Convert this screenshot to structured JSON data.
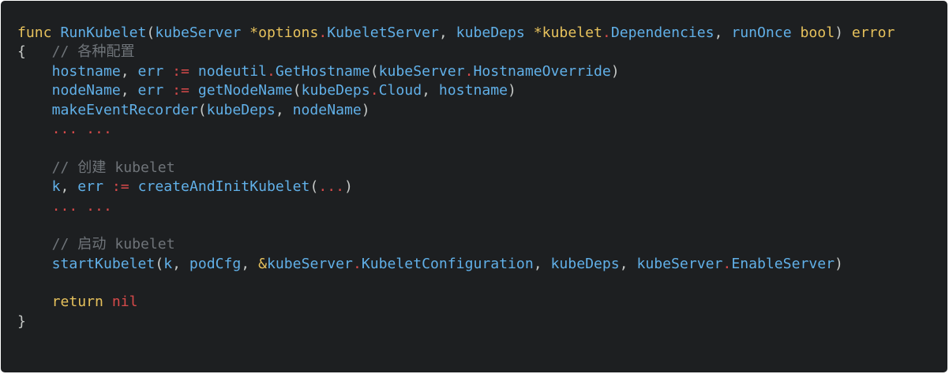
{
  "colors": {
    "background": "#1d1f21",
    "keyword": "#e6c15c",
    "identifier": "#61b0e8",
    "punctuation": "#c5c8c6",
    "accent": "#d74a4a",
    "comment": "#6f7479"
  },
  "code": {
    "language": "go",
    "lines": [
      [
        {
          "t": "func",
          "c": "kw"
        },
        {
          "t": " ",
          "c": "pun"
        },
        {
          "t": "RunKubelet",
          "c": "id"
        },
        {
          "t": "(",
          "c": "pun"
        },
        {
          "t": "kubeServer",
          "c": "id"
        },
        {
          "t": " ",
          "c": "pun"
        },
        {
          "t": "*",
          "c": "kw"
        },
        {
          "t": "options",
          "c": "kw"
        },
        {
          "t": ".",
          "c": "acc"
        },
        {
          "t": "KubeletServer",
          "c": "id"
        },
        {
          "t": ", ",
          "c": "pun"
        },
        {
          "t": "kubeDeps",
          "c": "id"
        },
        {
          "t": " ",
          "c": "pun"
        },
        {
          "t": "*",
          "c": "kw"
        },
        {
          "t": "kubelet",
          "c": "kw"
        },
        {
          "t": ".",
          "c": "acc"
        },
        {
          "t": "Dependencies",
          "c": "id"
        },
        {
          "t": ", ",
          "c": "pun"
        },
        {
          "t": "runOnce",
          "c": "id"
        },
        {
          "t": " ",
          "c": "pun"
        },
        {
          "t": "bool",
          "c": "kw"
        },
        {
          "t": ") ",
          "c": "pun"
        },
        {
          "t": "error",
          "c": "kw"
        }
      ],
      [
        {
          "t": "{",
          "c": "pun"
        },
        {
          "t": "   ",
          "c": "pun"
        },
        {
          "t": "// 各种配置",
          "c": "cm"
        }
      ],
      [
        {
          "t": "    ",
          "c": "pun"
        },
        {
          "t": "hostname",
          "c": "id"
        },
        {
          "t": ", ",
          "c": "pun"
        },
        {
          "t": "err",
          "c": "id"
        },
        {
          "t": " ",
          "c": "pun"
        },
        {
          "t": ":=",
          "c": "acc"
        },
        {
          "t": " ",
          "c": "pun"
        },
        {
          "t": "nodeutil",
          "c": "id"
        },
        {
          "t": ".",
          "c": "acc"
        },
        {
          "t": "GetHostname",
          "c": "id"
        },
        {
          "t": "(",
          "c": "pun"
        },
        {
          "t": "kubeServer",
          "c": "id"
        },
        {
          "t": ".",
          "c": "acc"
        },
        {
          "t": "HostnameOverride",
          "c": "id"
        },
        {
          "t": ")",
          "c": "pun"
        }
      ],
      [
        {
          "t": "    ",
          "c": "pun"
        },
        {
          "t": "nodeName",
          "c": "id"
        },
        {
          "t": ", ",
          "c": "pun"
        },
        {
          "t": "err",
          "c": "id"
        },
        {
          "t": " ",
          "c": "pun"
        },
        {
          "t": ":=",
          "c": "acc"
        },
        {
          "t": " ",
          "c": "pun"
        },
        {
          "t": "getNodeName",
          "c": "id"
        },
        {
          "t": "(",
          "c": "pun"
        },
        {
          "t": "kubeDeps",
          "c": "id"
        },
        {
          "t": ".",
          "c": "acc"
        },
        {
          "t": "Cloud",
          "c": "id"
        },
        {
          "t": ", ",
          "c": "pun"
        },
        {
          "t": "hostname",
          "c": "id"
        },
        {
          "t": ")",
          "c": "pun"
        }
      ],
      [
        {
          "t": "    ",
          "c": "pun"
        },
        {
          "t": "makeEventRecorder",
          "c": "id"
        },
        {
          "t": "(",
          "c": "pun"
        },
        {
          "t": "kubeDeps",
          "c": "id"
        },
        {
          "t": ", ",
          "c": "pun"
        },
        {
          "t": "nodeName",
          "c": "id"
        },
        {
          "t": ")",
          "c": "pun"
        }
      ],
      [
        {
          "t": "    ",
          "c": "pun"
        },
        {
          "t": "... ...",
          "c": "acc"
        }
      ],
      [],
      [
        {
          "t": "    ",
          "c": "pun"
        },
        {
          "t": "// 创建 kubelet",
          "c": "cm"
        }
      ],
      [
        {
          "t": "    ",
          "c": "pun"
        },
        {
          "t": "k",
          "c": "id"
        },
        {
          "t": ", ",
          "c": "pun"
        },
        {
          "t": "err",
          "c": "id"
        },
        {
          "t": " ",
          "c": "pun"
        },
        {
          "t": ":=",
          "c": "acc"
        },
        {
          "t": " ",
          "c": "pun"
        },
        {
          "t": "createAndInitKubelet",
          "c": "id"
        },
        {
          "t": "(",
          "c": "pun"
        },
        {
          "t": "...",
          "c": "acc"
        },
        {
          "t": ")",
          "c": "pun"
        }
      ],
      [
        {
          "t": "    ",
          "c": "pun"
        },
        {
          "t": "... ...",
          "c": "acc"
        }
      ],
      [],
      [
        {
          "t": "    ",
          "c": "pun"
        },
        {
          "t": "// 启动 kubelet",
          "c": "cm"
        }
      ],
      [
        {
          "t": "    ",
          "c": "pun"
        },
        {
          "t": "startKubelet",
          "c": "id"
        },
        {
          "t": "(",
          "c": "pun"
        },
        {
          "t": "k",
          "c": "id"
        },
        {
          "t": ", ",
          "c": "pun"
        },
        {
          "t": "podCfg",
          "c": "id"
        },
        {
          "t": ", ",
          "c": "pun"
        },
        {
          "t": "&",
          "c": "kw"
        },
        {
          "t": "kubeServer",
          "c": "id"
        },
        {
          "t": ".",
          "c": "acc"
        },
        {
          "t": "KubeletConfiguration",
          "c": "id"
        },
        {
          "t": ", ",
          "c": "pun"
        },
        {
          "t": "kubeDeps",
          "c": "id"
        },
        {
          "t": ", ",
          "c": "pun"
        },
        {
          "t": "kubeServer",
          "c": "id"
        },
        {
          "t": ".",
          "c": "acc"
        },
        {
          "t": "EnableServer",
          "c": "id"
        },
        {
          "t": ")",
          "c": "pun"
        }
      ],
      [],
      [
        {
          "t": "    ",
          "c": "pun"
        },
        {
          "t": "return",
          "c": "kw"
        },
        {
          "t": " ",
          "c": "pun"
        },
        {
          "t": "nil",
          "c": "acc"
        }
      ],
      [
        {
          "t": "}",
          "c": "pun"
        }
      ]
    ]
  }
}
